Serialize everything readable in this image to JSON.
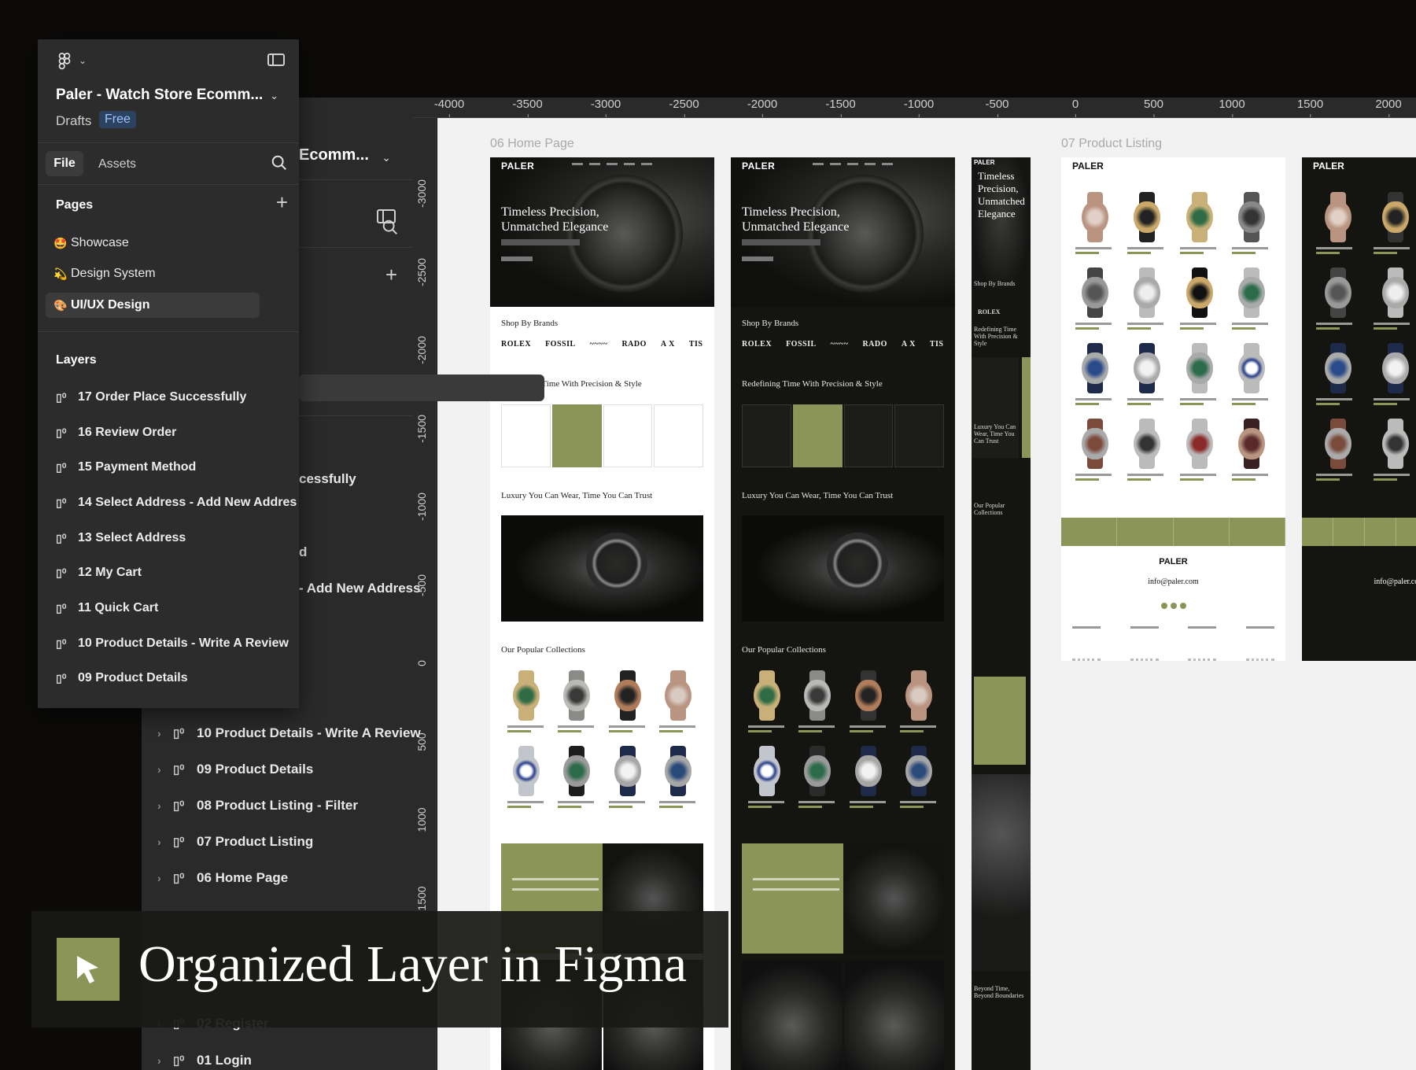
{
  "colors": {
    "accent": "#8b9558",
    "panel": "#2c2c2c",
    "canvas": "#f2f2f2",
    "free_badge": "#9fc3ff"
  },
  "front_panel": {
    "file_name": "Paler - Watch Store Ecomm...",
    "drafts": "Drafts",
    "plan": "Free",
    "tabs": {
      "file": "File",
      "assets": "Assets"
    },
    "pages_heading": "Pages",
    "pages": [
      {
        "emoji": "🤩",
        "label": "Showcase"
      },
      {
        "emoji": "💫",
        "label": "Design System"
      },
      {
        "emoji": "🎨",
        "label": "UI/UX Design"
      }
    ],
    "layers_heading": "Layers",
    "layers": [
      "17 Order Place Successfully",
      "16 Review Order",
      "15 Payment Method",
      "14 Select Address - Add New Addres",
      "13 Select Address",
      "12 My Cart",
      "11 Quick Cart",
      "10 Product Details - Write A Review",
      "09 Product Details"
    ]
  },
  "back_panel": {
    "file_name": "Ecomm...",
    "fragments": [
      "cessfully",
      "d",
      "- Add New Address"
    ],
    "layers": [
      "10 Product Details - Write A Review",
      "09 Product Details",
      "08 Product Listing - Filter",
      "07 Product Listing",
      "06 Home Page",
      "02 Register",
      "01 Login"
    ]
  },
  "ruler_top": [
    "-4000",
    "-3500",
    "-3000",
    "-2500",
    "-2000",
    "-1500",
    "-1000",
    "-500",
    "0",
    "500",
    "1000",
    "1500",
    "2000"
  ],
  "ruler_left": [
    "-3000",
    "-2500",
    "-2000",
    "-1500",
    "-1000",
    "-500",
    "0",
    "500",
    "1000",
    "1500"
  ],
  "canvas": {
    "frame_home": "06 Home Page",
    "frame_listing": "07 Product Listing",
    "brand": "PALER",
    "hero_heading": "Timeless Precision, Unmatched Elegance",
    "hero_heading_narrow": "Timeless Precision, Unmatched Elegance",
    "shop_by_brands": "Shop By Brands",
    "brands": [
      "ROLEX",
      "FOSSIL",
      "~~~~",
      "RADO",
      "A X",
      "TIS"
    ],
    "redefining": "Redefining Time With Precision & Style",
    "luxury": "Luxury You Can Wear, Time You Can Trust",
    "popular": "Our Popular Collections",
    "narrow_redefining": "Redefining Time With Precision & Style",
    "narrow_luxury": "Luxury You Can Wear, Time You Can Trust",
    "narrow_popular": "Our Popular Collections",
    "narrow_beyond": "Beyond Time, Beyond Boundaries",
    "listing_mail": "info@paler.com"
  },
  "banner": {
    "text": "Organized Layer in Figma",
    "icon": "cursor-icon"
  }
}
